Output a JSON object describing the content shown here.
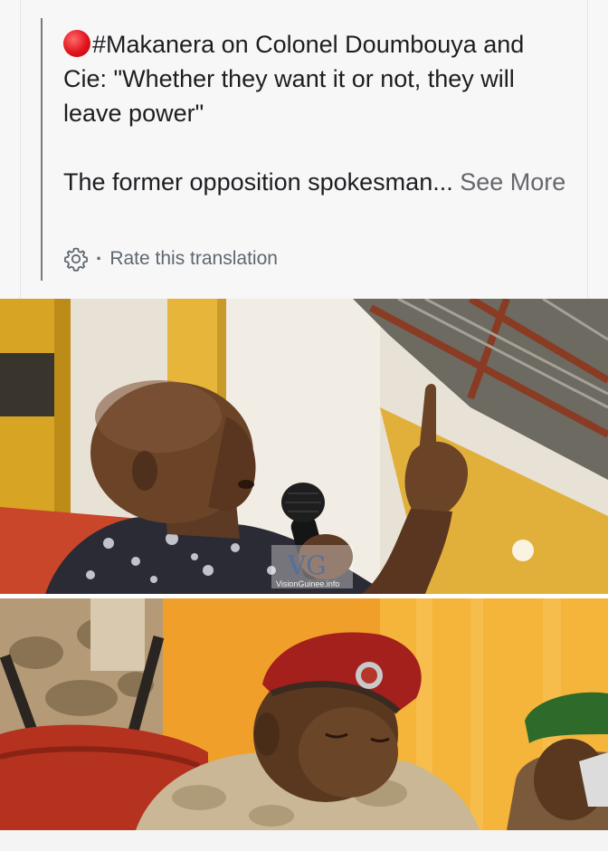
{
  "post": {
    "headline_tag": "#Makanera on Colonel Doumbouya and Cie: \"Whether they want it or not, they will leave power\"",
    "body_preview": "The former opposition spokesman... ",
    "see_more_label": "See More",
    "status_emoji": "red-circle-icon"
  },
  "translation": {
    "icon": "gear-icon",
    "separator": "·",
    "rate_label": "Rate this translation"
  },
  "photos": {
    "top_watermark": "VisionGuinee.info"
  },
  "colors": {
    "red_dot": "#e0141c",
    "muted_text": "#65676b",
    "card_bg": "#f7f7f7",
    "beret_red": "#a3201c",
    "beret_green": "#2e6b2a"
  }
}
